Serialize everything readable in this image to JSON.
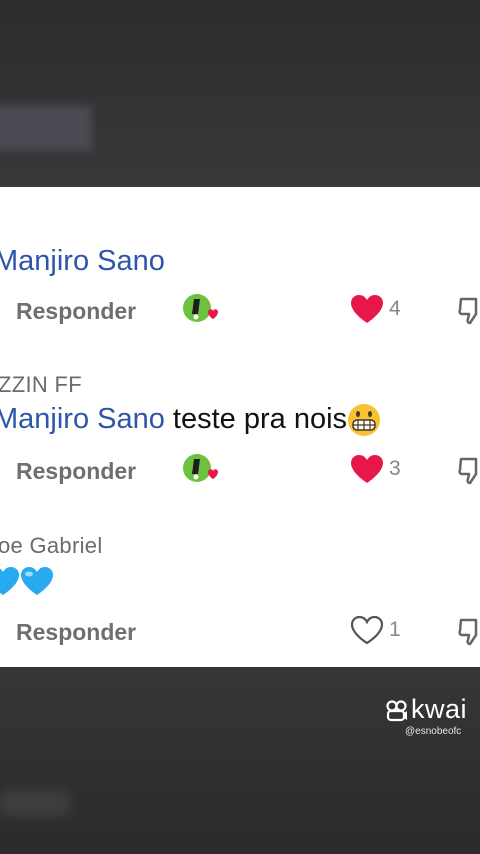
{
  "comments": [
    {
      "author": "",
      "mention": "Manjiro Sano",
      "text": "",
      "reply_label": "Responder",
      "like_count": "4",
      "liked": true
    },
    {
      "author": "ZZIN FF",
      "mention": "Manjiro Sano",
      "text": " teste pra nois",
      "reply_label": "Responder",
      "like_count": "3",
      "liked": true
    },
    {
      "author": "oe Gabriel",
      "mention": "",
      "text": "",
      "reply_label": "Responder",
      "like_count": "1",
      "liked": false
    }
  ],
  "watermark": {
    "brand": "kwai",
    "handle": "@esnobeofc"
  },
  "colors": {
    "mention": "#2e56a8",
    "like": "#e8174a",
    "heart_blue": "#29a9f0"
  },
  "icons": [
    "creator-badge-icon",
    "heart-icon",
    "dislike-icon",
    "grimace-emoji",
    "blue-heart-emoji",
    "kwai-logo-icon"
  ]
}
